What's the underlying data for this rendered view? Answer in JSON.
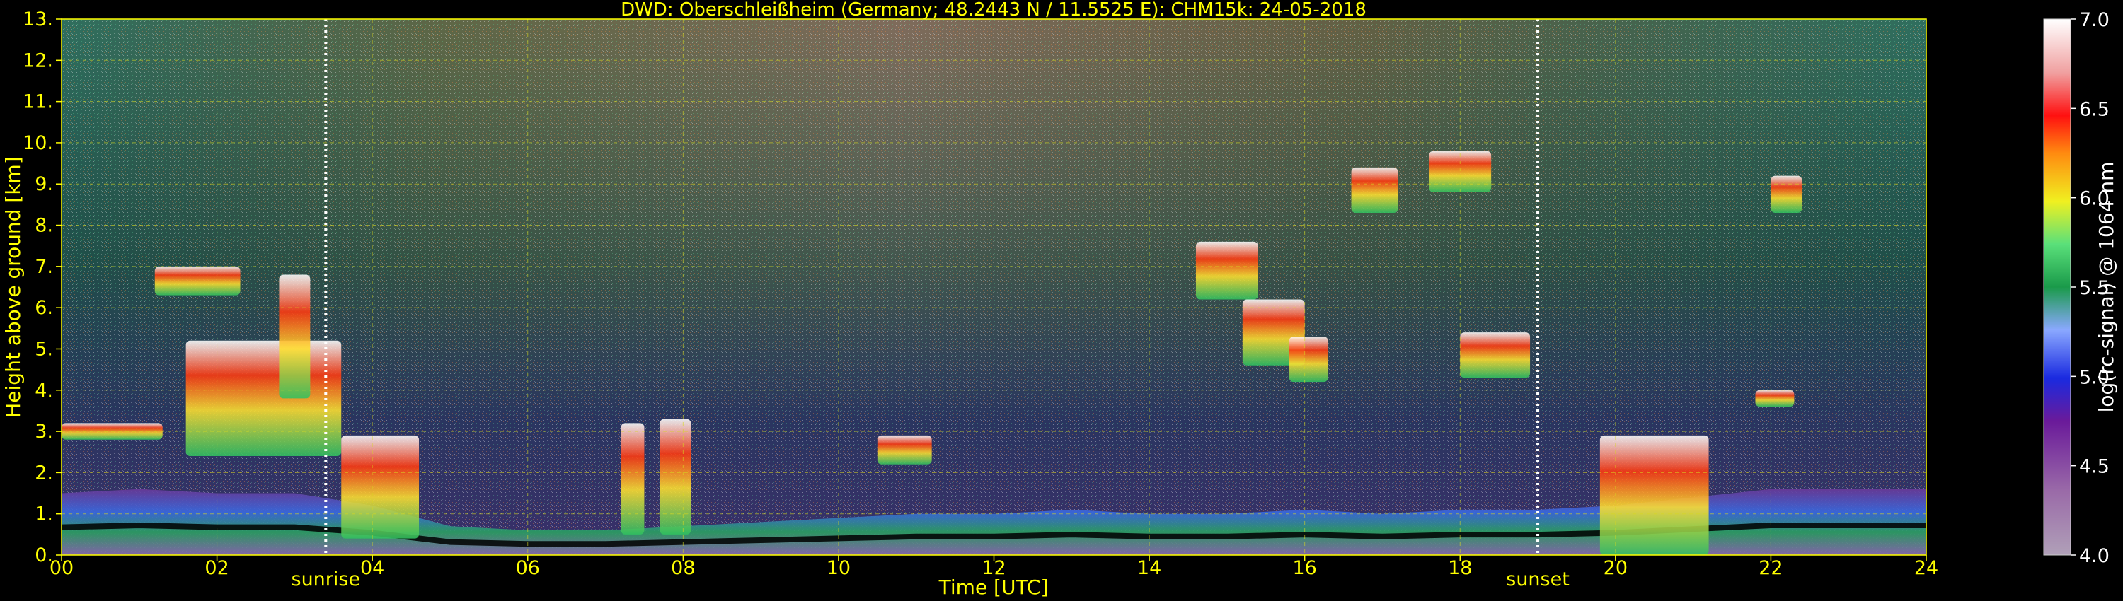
{
  "chart_data": {
    "type": "heatmap",
    "title": "DWD: Oberschleißheim (Germany; 48.2443 N / 11.5525 E):    CHM15k: 24-05-2018",
    "xlabel": "Time [UTC]",
    "ylabel": "Height above ground [km]",
    "xlim": [
      0,
      24
    ],
    "ylim": [
      0,
      13
    ],
    "x_ticks": [
      "00",
      "02",
      "04",
      "06",
      "08",
      "10",
      "12",
      "14",
      "16",
      "18",
      "20",
      "22",
      "24"
    ],
    "y_ticks": [
      "0.",
      "1.",
      "2.",
      "3.",
      "4.",
      "5.",
      "6.",
      "7.",
      "8.",
      "9.",
      "10.",
      "11.",
      "12.",
      "13."
    ],
    "grid": true,
    "colorbar": {
      "label": "log(rc-signal) @ 1064 nm",
      "range": [
        4.0,
        7.0
      ],
      "ticks": [
        "4.0",
        "4.5",
        "5.0",
        "5.5",
        "6.0",
        "6.5",
        "7.0"
      ]
    },
    "markers": [
      {
        "label": "sunrise",
        "time": 3.4
      },
      {
        "label": "sunset",
        "time": 19.0
      }
    ],
    "layers": [
      {
        "name": "boundary layer",
        "times": [
          0,
          1,
          2,
          3,
          4,
          5,
          6,
          7,
          8,
          9,
          10,
          11,
          12,
          13,
          14,
          15,
          16,
          17,
          18,
          19,
          20,
          21,
          22,
          23,
          24
        ],
        "tops": [
          1.5,
          1.6,
          1.5,
          1.5,
          1.2,
          0.7,
          0.6,
          0.6,
          0.7,
          0.8,
          0.9,
          1.0,
          1.0,
          1.1,
          1.0,
          1.0,
          1.1,
          1.0,
          1.1,
          1.1,
          1.2,
          1.4,
          1.6,
          1.6,
          1.6
        ]
      },
      {
        "name": "cloud",
        "t0": 0.0,
        "t1": 1.3,
        "h0": 2.8,
        "h1": 3.2
      },
      {
        "name": "cloud",
        "t0": 1.2,
        "t1": 2.3,
        "h0": 6.3,
        "h1": 7.0
      },
      {
        "name": "cloud",
        "t0": 1.6,
        "t1": 3.6,
        "h0": 2.4,
        "h1": 5.2
      },
      {
        "name": "cloud",
        "t0": 2.8,
        "t1": 3.2,
        "h0": 3.8,
        "h1": 6.8
      },
      {
        "name": "cloud",
        "t0": 3.6,
        "t1": 4.6,
        "h0": 0.4,
        "h1": 2.9
      },
      {
        "name": "cloud",
        "t0": 7.2,
        "t1": 7.5,
        "h0": 0.5,
        "h1": 3.2
      },
      {
        "name": "cloud",
        "t0": 7.7,
        "t1": 8.1,
        "h0": 0.5,
        "h1": 3.3
      },
      {
        "name": "cloud",
        "t0": 10.5,
        "t1": 11.2,
        "h0": 2.2,
        "h1": 2.9
      },
      {
        "name": "cloud",
        "t0": 14.6,
        "t1": 15.4,
        "h0": 6.2,
        "h1": 7.6
      },
      {
        "name": "cloud",
        "t0": 15.2,
        "t1": 16.0,
        "h0": 4.6,
        "h1": 6.2
      },
      {
        "name": "cloud",
        "t0": 15.8,
        "t1": 16.3,
        "h0": 4.2,
        "h1": 5.3
      },
      {
        "name": "cloud",
        "t0": 16.6,
        "t1": 17.2,
        "h0": 8.3,
        "h1": 9.4
      },
      {
        "name": "cloud",
        "t0": 17.6,
        "t1": 18.4,
        "h0": 8.8,
        "h1": 9.8
      },
      {
        "name": "cloud",
        "t0": 18.0,
        "t1": 18.9,
        "h0": 4.3,
        "h1": 5.4
      },
      {
        "name": "cloud",
        "t0": 19.8,
        "t1": 21.2,
        "h0": 0.0,
        "h1": 2.9
      },
      {
        "name": "cloud",
        "t0": 21.8,
        "t1": 22.3,
        "h0": 3.6,
        "h1": 4.0
      },
      {
        "name": "cloud",
        "t0": 22.0,
        "t1": 22.4,
        "h0": 8.3,
        "h1": 9.2
      }
    ]
  }
}
